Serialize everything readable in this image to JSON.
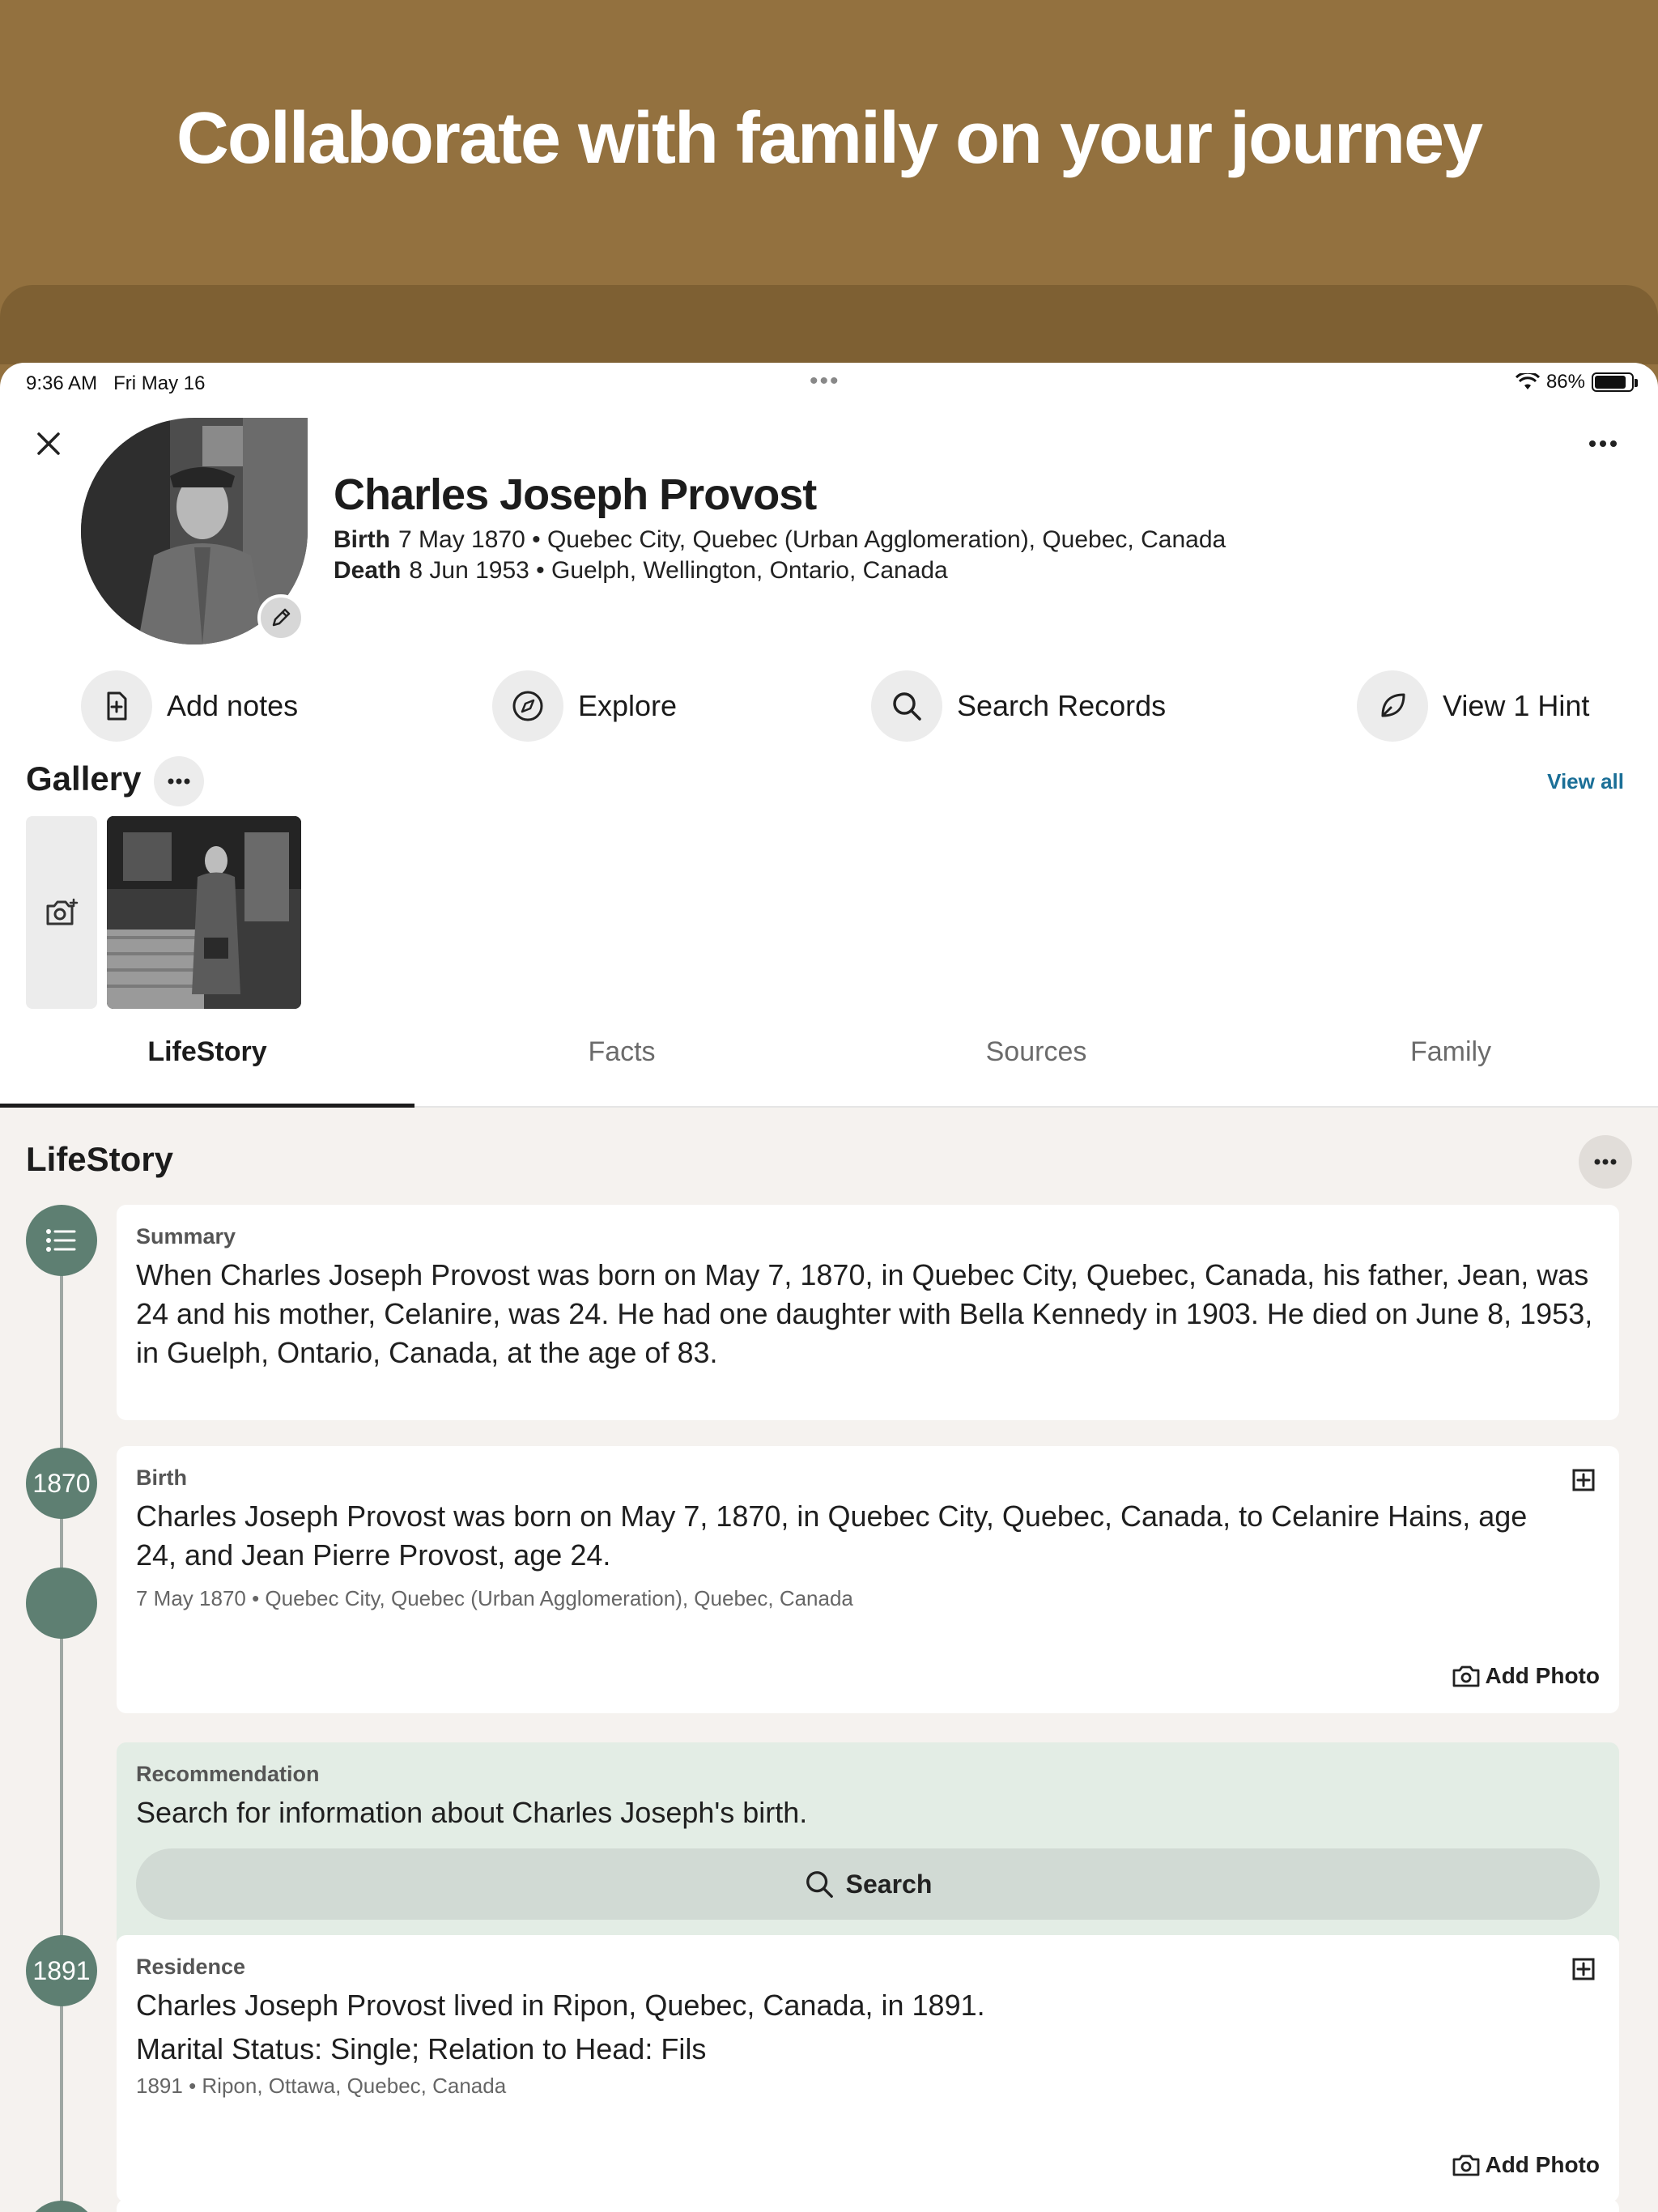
{
  "banner": {
    "title": "Collaborate with family on your journey"
  },
  "status_bar": {
    "time": "9:36 AM",
    "date": "Fri May 16",
    "battery": "86%",
    "battery_level": 0.86
  },
  "person": {
    "name": "Charles Joseph Provost",
    "birth_label": "Birth",
    "birth_value": "7 May 1870 • Quebec City, Quebec (Urban Agglomeration), Quebec, Canada",
    "death_label": "Death",
    "death_value": "8 Jun 1953 • Guelph, Wellington, Ontario, Canada"
  },
  "actions": [
    {
      "label": "Add notes",
      "icon": "add-note-icon"
    },
    {
      "label": "Explore",
      "icon": "compass-icon"
    },
    {
      "label": "Search Records",
      "icon": "search-icon"
    },
    {
      "label": "View 1 Hint",
      "icon": "leaf-icon"
    }
  ],
  "gallery": {
    "title": "Gallery",
    "view_all": "View all"
  },
  "tabs": [
    {
      "label": "LifeStory",
      "active": true
    },
    {
      "label": "Facts",
      "active": false
    },
    {
      "label": "Sources",
      "active": false
    },
    {
      "label": "Family",
      "active": false
    }
  ],
  "lifestory": {
    "title": "LifeStory",
    "summary": {
      "label": "Summary",
      "text": "When Charles Joseph Provost was born on May 7, 1870, in Quebec City, Quebec, Canada, his father, Jean, was 24 and his mother, Celanire, was 24. He had one daughter with Bella Kennedy in 1903. He died on June 8, 1953, in Guelph, Ontario, Canada, at the age of 83."
    },
    "birth": {
      "year": "1870",
      "label": "Birth",
      "text": "Charles Joseph Provost was born on May 7, 1870, in Quebec City, Quebec, Canada, to Celanire Hains, age 24, and Jean Pierre Provost, age 24.",
      "meta": "7 May 1870 • Quebec City, Quebec (Urban Agglomeration), Quebec, Canada",
      "add_photo": "Add Photo"
    },
    "recommendation": {
      "label": "Recommendation",
      "text": "Search for information about Charles Joseph's birth.",
      "button": "Search"
    },
    "residence": {
      "year": "1891",
      "label": "Residence",
      "text": "Charles Joseph Provost lived in Ripon, Quebec, Canada, in 1891.",
      "text2": "Marital Status: Single; Relation to Head: Fils",
      "meta": "1891 • Ripon, Ottawa, Quebec, Canada",
      "add_photo": "Add Photo"
    }
  },
  "colors": {
    "banner": "#93713f",
    "timeline_node": "#5e7f72",
    "link": "#1b6f97",
    "recommendation_bg": "#e3ede5"
  }
}
